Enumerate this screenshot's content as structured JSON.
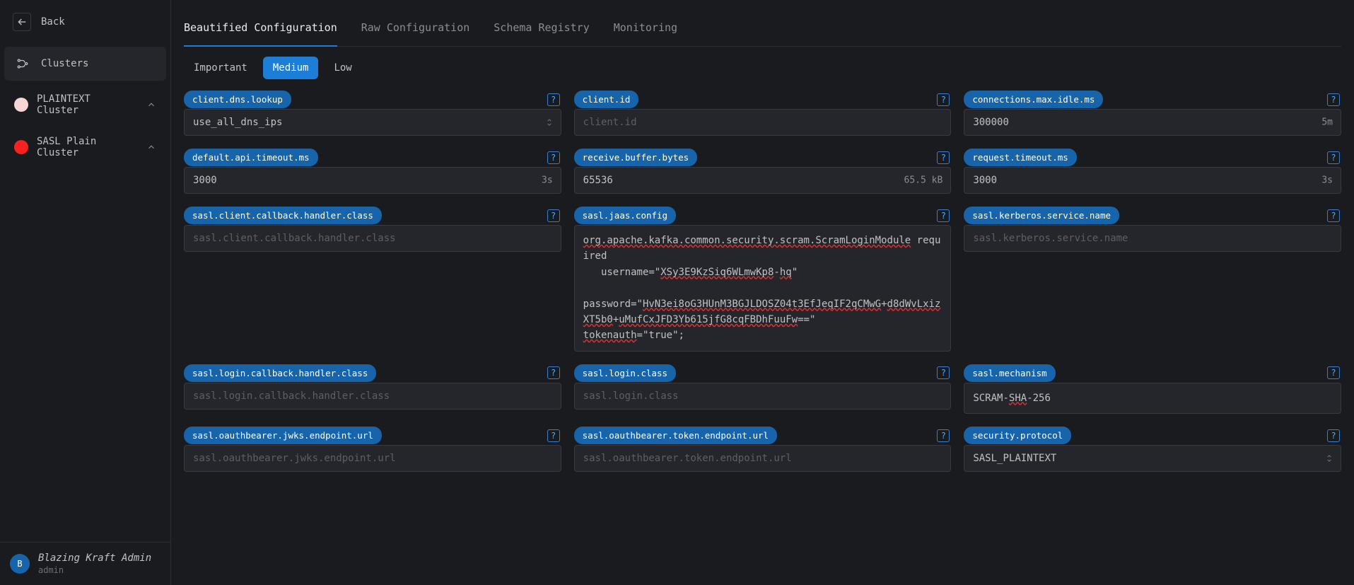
{
  "sidebar": {
    "back_label": "Back",
    "clusters_label": "Clusters",
    "items": [
      {
        "label": "PLAINTEXT Cluster",
        "color": "pink"
      },
      {
        "label": "SASL Plain Cluster",
        "color": "red"
      }
    ],
    "user": {
      "initial": "B",
      "name": "Blazing Kraft Admin",
      "sub": "admin"
    }
  },
  "tabs_primary": [
    {
      "label": "Beautified Configuration",
      "active": true
    },
    {
      "label": "Raw Configuration",
      "active": false
    },
    {
      "label": "Schema Registry",
      "active": false
    },
    {
      "label": "Monitoring",
      "active": false
    }
  ],
  "tabs_secondary": [
    {
      "label": "Important",
      "active": false
    },
    {
      "label": "Medium",
      "active": true
    },
    {
      "label": "Low",
      "active": false
    }
  ],
  "fields": {
    "client_dns_lookup": {
      "name": "client.dns.lookup",
      "value": "use_all_dns_ips"
    },
    "client_id": {
      "name": "client.id",
      "placeholder": "client.id",
      "value": ""
    },
    "connections_max_idle_ms": {
      "name": "connections.max.idle.ms",
      "value": "300000",
      "suffix": "5m"
    },
    "default_api_timeout_ms": {
      "name": "default.api.timeout.ms",
      "value": "3000",
      "suffix": "3s"
    },
    "receive_buffer_bytes": {
      "name": "receive.buffer.bytes",
      "value": "65536",
      "suffix": "65.5 kB"
    },
    "request_timeout_ms": {
      "name": "request.timeout.ms",
      "value": "3000",
      "suffix": "3s"
    },
    "sasl_client_callback_handler_class": {
      "name": "sasl.client.callback.handler.class",
      "placeholder": "sasl.client.callback.handler.class",
      "value": ""
    },
    "sasl_jaas_config": {
      "name": "sasl.jaas.config",
      "segments": [
        {
          "t": "org.apache.kafka.common.security.scram.ScramLoginModule",
          "u": true
        },
        {
          "t": " required\n   username=\""
        },
        {
          "t": "XSy3E9KzSiq6WLmwKp8",
          "u": true
        },
        {
          "t": "-"
        },
        {
          "t": "hq",
          "u": true
        },
        {
          "t": "\"\n\npassword=\""
        },
        {
          "t": "HvN3ei8oG3HUnM3BGJLDOSZ04t3EfJeqIF2qCMwG",
          "u": true
        },
        {
          "t": "+"
        },
        {
          "t": "d8dWvLxizXT5b0",
          "u": true
        },
        {
          "t": "+"
        },
        {
          "t": "uMufCxJFD3Yb615jfG8cqFBDhFuuFw",
          "u": true
        },
        {
          "t": "==\"\n"
        },
        {
          "t": "tokenauth",
          "u": true
        },
        {
          "t": "=\"true\";"
        }
      ]
    },
    "sasl_kerberos_service_name": {
      "name": "sasl.kerberos.service.name",
      "placeholder": "sasl.kerberos.service.name",
      "value": ""
    },
    "sasl_login_callback_handler_class": {
      "name": "sasl.login.callback.handler.class",
      "placeholder": "sasl.login.callback.handler.class",
      "value": ""
    },
    "sasl_login_class": {
      "name": "sasl.login.class",
      "placeholder": "sasl.login.class",
      "value": ""
    },
    "sasl_mechanism": {
      "name": "sasl.mechanism",
      "segments": [
        {
          "t": "SCRAM-"
        },
        {
          "t": "SHA",
          "u": true
        },
        {
          "t": "-256"
        }
      ]
    },
    "sasl_oauthbearer_jwks_endpoint_url": {
      "name": "sasl.oauthbearer.jwks.endpoint.url",
      "placeholder": "sasl.oauthbearer.jwks.endpoint.url",
      "value": ""
    },
    "sasl_oauthbearer_token_endpoint_url": {
      "name": "sasl.oauthbearer.token.endpoint.url",
      "placeholder": "sasl.oauthbearer.token.endpoint.url",
      "value": ""
    },
    "security_protocol": {
      "name": "security.protocol",
      "value": "SASL_PLAINTEXT"
    }
  },
  "help_glyph": "?"
}
